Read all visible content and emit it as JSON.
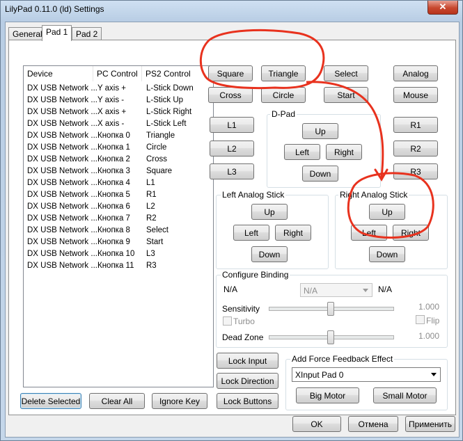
{
  "window": {
    "title": "LilyPad 0.11.0 (ld) Settings",
    "close": "✕"
  },
  "tabs": [
    "General",
    "Pad 1",
    "Pad 2"
  ],
  "list": {
    "headers": [
      "Device",
      "PC Control",
      "PS2 Control"
    ],
    "rows": [
      [
        "DX USB Network ...",
        "Y axis +",
        "L-Stick Down"
      ],
      [
        "DX USB Network ...",
        "Y axis -",
        "L-Stick Up"
      ],
      [
        "DX USB Network ...",
        "X axis +",
        "L-Stick Right"
      ],
      [
        "DX USB Network ...",
        "X axis -",
        "L-Stick Left"
      ],
      [
        "DX USB Network ...",
        "Кнопка 0",
        "Triangle"
      ],
      [
        "DX USB Network ...",
        "Кнопка 1",
        "Circle"
      ],
      [
        "DX USB Network ...",
        "Кнопка 2",
        "Cross"
      ],
      [
        "DX USB Network ...",
        "Кнопка 3",
        "Square"
      ],
      [
        "DX USB Network ...",
        "Кнопка 4",
        "L1"
      ],
      [
        "DX USB Network ...",
        "Кнопка 5",
        "R1"
      ],
      [
        "DX USB Network ...",
        "Кнопка 6",
        "L2"
      ],
      [
        "DX USB Network ...",
        "Кнопка 7",
        "R2"
      ],
      [
        "DX USB Network ...",
        "Кнопка 8",
        "Select"
      ],
      [
        "DX USB Network ...",
        "Кнопка 9",
        "Start"
      ],
      [
        "DX USB Network ...",
        "Кнопка 10",
        "L3"
      ],
      [
        "DX USB Network ...",
        "Кнопка 11",
        "R3"
      ]
    ]
  },
  "face": {
    "square": "Square",
    "triangle": "Triangle",
    "cross": "Cross",
    "circle": "Circle",
    "select": "Select",
    "start": "Start",
    "analog": "Analog",
    "mouse": "Mouse"
  },
  "shoulders": {
    "l1": "L1",
    "l2": "L2",
    "l3": "L3",
    "r1": "R1",
    "r2": "R2",
    "r3": "R3"
  },
  "dpad": {
    "label": "D-Pad",
    "up": "Up",
    "left": "Left",
    "right": "Right",
    "down": "Down"
  },
  "left_stick": {
    "label": "Left Analog Stick",
    "up": "Up",
    "left": "Left",
    "right": "Right",
    "down": "Down"
  },
  "right_stick": {
    "label": "Right Analog Stick",
    "up": "Up",
    "left": "Left",
    "right": "Right",
    "down": "Down"
  },
  "binding": {
    "label": "Configure Binding",
    "na_left": "N/A",
    "combo": "N/A",
    "na_right": "N/A",
    "sensitivity": "Sensitivity",
    "sensitivity_value": "1.000",
    "turbo": "Turbo",
    "flip": "Flip",
    "dead_zone": "Dead Zone",
    "dead_zone_value": "1.000"
  },
  "lock": {
    "input": "Lock Input",
    "direction": "Lock Direction",
    "buttons": "Lock Buttons"
  },
  "ffb": {
    "label": "Add Force Feedback Effect",
    "device": "XInput Pad 0",
    "big": "Big Motor",
    "small": "Small Motor"
  },
  "bottom": {
    "delete": "Delete Selected",
    "clear": "Clear All",
    "ignore": "Ignore Key"
  },
  "dialog": {
    "ok": "OK",
    "cancel": "Отмена",
    "apply": "Применить"
  },
  "colors": {
    "annotation": "#e8321e",
    "titlebar": "#b9d1ea",
    "close": "#c7472e"
  }
}
